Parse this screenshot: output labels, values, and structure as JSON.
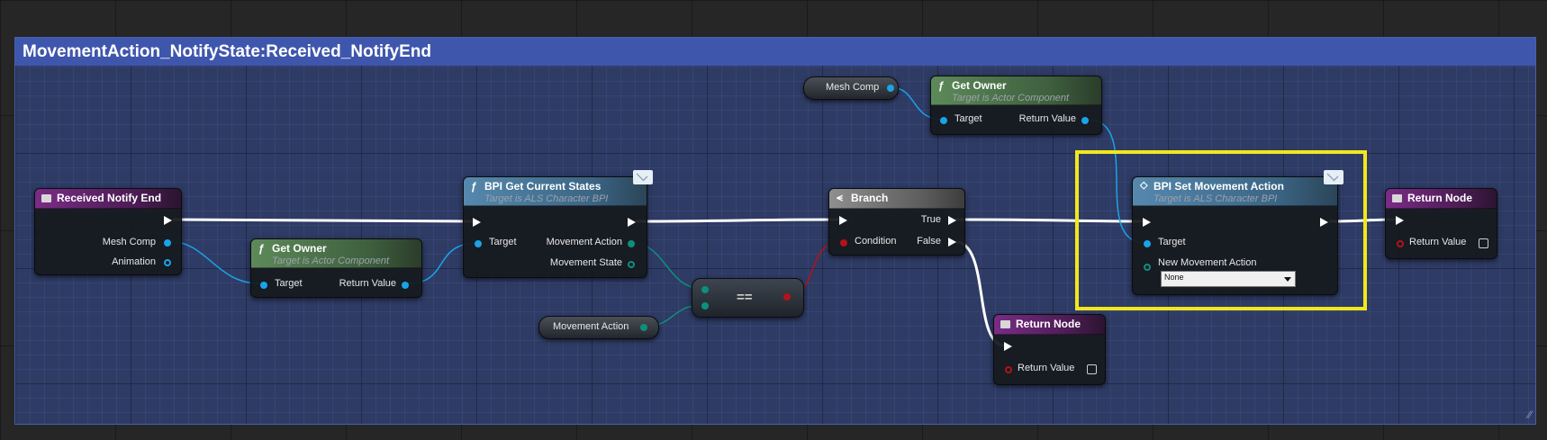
{
  "comment": {
    "title": "MovementAction_NotifyState:Received_NotifyEnd"
  },
  "colors": {
    "highlight": "#f2e71c",
    "object_pin": "#1aa3e8",
    "enum_pin": "#0e8f7d",
    "bool_pin": "#b3121a",
    "exec_pin": "#ffffff"
  },
  "nodes": {
    "received_notify_end": {
      "title": "Received Notify End",
      "pins": {
        "mesh_comp": "Mesh Comp",
        "animation": "Animation"
      }
    },
    "get_owner_1": {
      "icon": "function-icon",
      "title": "Get Owner",
      "subtitle": "Target is Actor Component",
      "pins": {
        "target": "Target",
        "return_value": "Return Value"
      }
    },
    "get_owner_2": {
      "icon": "function-icon",
      "title": "Get Owner",
      "subtitle": "Target is Actor Component",
      "pins": {
        "target": "Target",
        "return_value": "Return Value"
      }
    },
    "bpi_get_current_states": {
      "icon": "function-icon",
      "title": "BPI Get Current States",
      "subtitle": "Target is ALS Character BPI",
      "pins": {
        "target": "Target",
        "movement_action": "Movement Action",
        "movement_state": "Movement State"
      }
    },
    "mesh_comp_var": {
      "label": "Mesh Comp"
    },
    "movement_action_var": {
      "label": "Movement Action"
    },
    "equal": {
      "label": "=="
    },
    "branch": {
      "title": "Branch",
      "pins": {
        "true": "True",
        "false": "False",
        "condition": "Condition"
      }
    },
    "bpi_set_movement_action": {
      "title": "BPI Set Movement Action",
      "subtitle": "Target is ALS Character BPI",
      "pins": {
        "target": "Target",
        "new_movement_action": "New Movement Action"
      },
      "dropdown_value": "None"
    },
    "return_node_1": {
      "title": "Return Node",
      "pins": {
        "return_value": "Return Value"
      }
    },
    "return_node_2": {
      "title": "Return Node",
      "pins": {
        "return_value": "Return Value"
      }
    }
  },
  "glyphs": {
    "function": "ƒ",
    "resize": "⁄⁄"
  }
}
